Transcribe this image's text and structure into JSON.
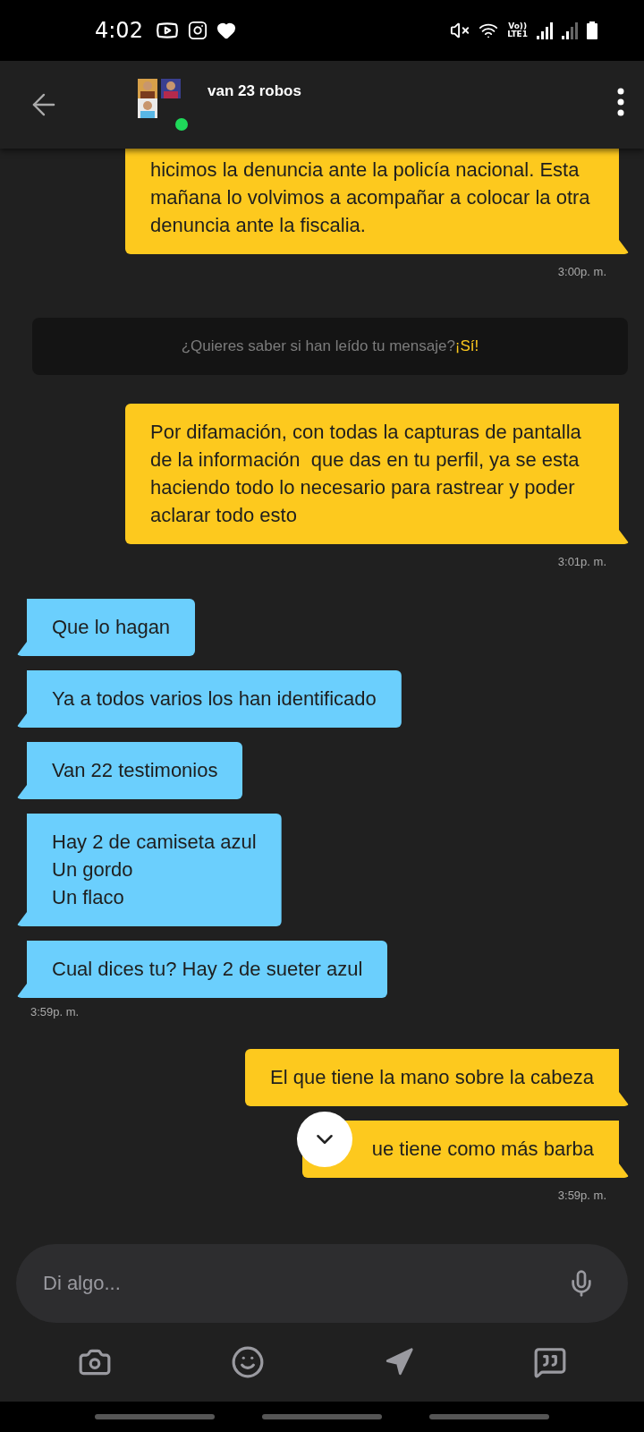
{
  "status_bar": {
    "time": "4:02",
    "network_top": "Vo))",
    "network_bottom": "LTE1"
  },
  "header": {
    "title": "van 23 robos",
    "online": true
  },
  "messages": [
    {
      "kind": "out",
      "lines": [
        "hicimos la denuncia ante la policía nacional. Esta",
        "mañana lo volvimos a acompañar a colocar la otra",
        "denuncia ante la fiscalia."
      ],
      "cut_top": true
    },
    {
      "kind": "time",
      "text": "3:00p. m."
    },
    {
      "kind": "prompt",
      "text": "¿Quieres saber si han leído tu mensaje?",
      "link": "¡Sí!"
    },
    {
      "kind": "out",
      "lines": [
        "Por difamación, con todas la capturas de pantalla",
        "de la información  que das en tu perfil, ya se esta",
        "haciendo todo lo necesario para rastrear y poder",
        "aclarar todo esto"
      ]
    },
    {
      "kind": "time",
      "text": "3:01p. m."
    },
    {
      "kind": "in",
      "lines": [
        "Que lo hagan"
      ]
    },
    {
      "kind": "in",
      "lines": [
        "Ya a todos varios los han identificado"
      ]
    },
    {
      "kind": "in",
      "lines": [
        "Van 22 testimonios"
      ]
    },
    {
      "kind": "in",
      "lines": [
        "Hay 2 de camiseta azul",
        "Un gordo",
        "Un flaco"
      ]
    },
    {
      "kind": "in",
      "lines": [
        "Cual dices tu? Hay 2 de sueter azul"
      ]
    },
    {
      "kind": "time",
      "text": "3:59p. m."
    },
    {
      "kind": "out",
      "lines": [
        "El que tiene la mano sobre la cabeza"
      ]
    },
    {
      "kind": "out",
      "lines": [
        "ue tiene como más barba"
      ],
      "covered": true
    },
    {
      "kind": "time",
      "text": "3:59p. m."
    }
  ],
  "composer": {
    "placeholder": "Di algo..."
  }
}
